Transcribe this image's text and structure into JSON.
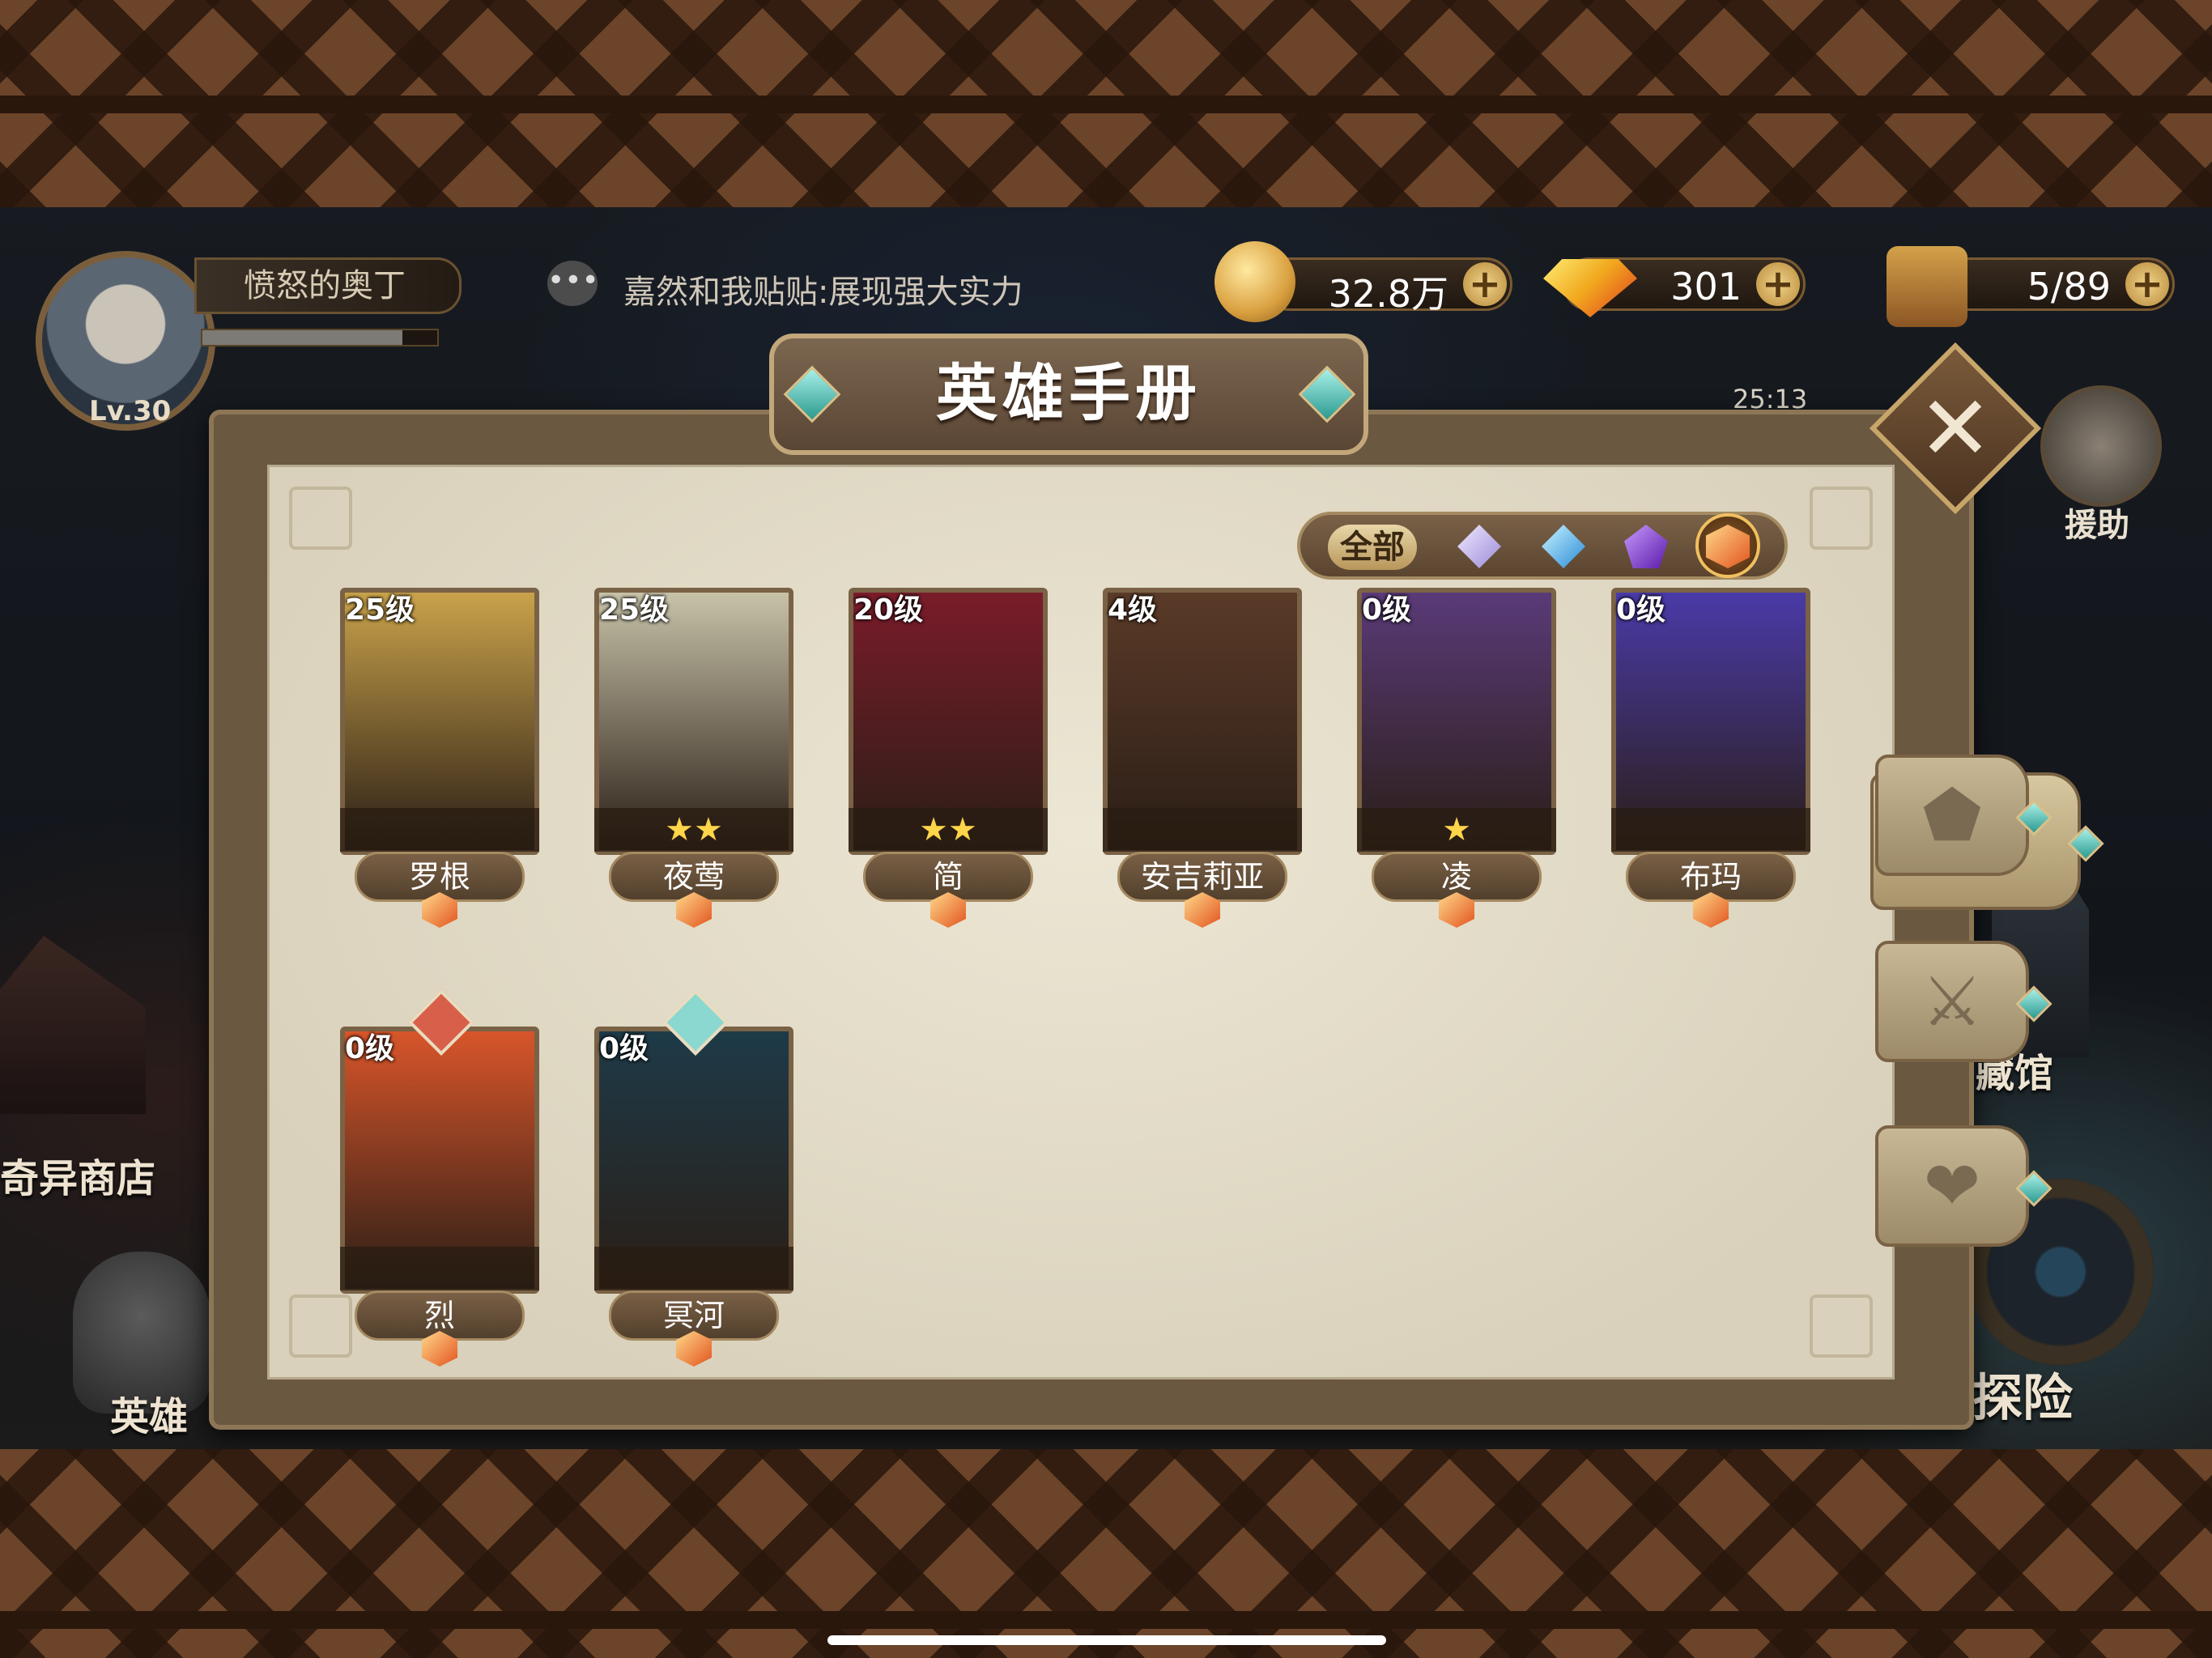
{
  "player": {
    "name": "愤怒的奥丁",
    "level": "Lv.30",
    "xp_fraction": 0.85
  },
  "chat": {
    "message": "嘉然和我贴贴:展现强大实力"
  },
  "resources": {
    "gold": "32.8万",
    "gems": "301",
    "stamina": "5/89",
    "plus": "+"
  },
  "timer": "25:13",
  "help_label": "援助",
  "background_labels": {
    "shop": "奇异商店",
    "heroes": "英雄",
    "museum": "藏馆",
    "explore": "探险"
  },
  "panel": {
    "title": "英雄手册",
    "close": "✕",
    "filter_all": "全部",
    "filters": [
      "purple-faction-icon",
      "blue-faction-icon",
      "violet-faction-icon",
      "orange-faction-icon"
    ],
    "selected_filter": "orange-faction-icon"
  },
  "heroes": [
    {
      "level": "25级",
      "name": "罗根",
      "stars": "",
      "palette": "#c9a24a"
    },
    {
      "level": "25级",
      "name": "夜莺",
      "stars": "★★",
      "palette": "#c7c2a8"
    },
    {
      "level": "20级",
      "name": "简",
      "stars": "★★",
      "palette": "#7a1c2a"
    },
    {
      "level": "4级",
      "name": "安吉莉亚",
      "stars": "",
      "palette": "#5a3a28"
    },
    {
      "level": "0级",
      "name": "凌",
      "stars": "★",
      "palette": "#5a3a78"
    },
    {
      "level": "0级",
      "name": "布玛",
      "stars": "",
      "palette": "#4a3aa8"
    },
    {
      "level": "0级",
      "name": "烈",
      "stars": "",
      "palette": "#d8552a"
    },
    {
      "level": "0级",
      "name": "冥河",
      "stars": "",
      "palette": "#1e3a48"
    }
  ],
  "side_tabs": [
    "grid-icon",
    "shield-icon",
    "sword-icon",
    "heart-icon"
  ]
}
